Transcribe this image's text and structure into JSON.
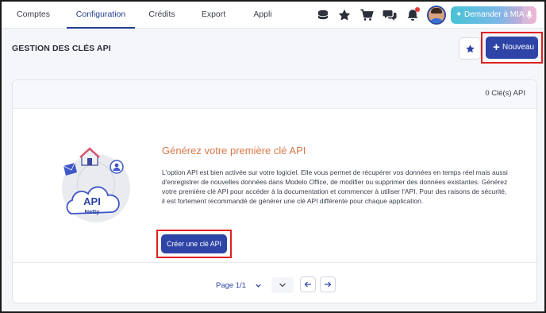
{
  "nav": {
    "tabs": [
      {
        "label": "Comptes",
        "active": false
      },
      {
        "label": "Configuration",
        "active": true
      },
      {
        "label": "Crédits",
        "active": false
      },
      {
        "label": "Export",
        "active": false
      },
      {
        "label": "Appli",
        "active": false
      }
    ],
    "icons": [
      "coins-icon",
      "star-icon",
      "cart-icon",
      "chat-icon",
      "bell-icon"
    ],
    "ask_button": "Demander à MIA"
  },
  "header": {
    "title": "GESTION DES CLÉS API",
    "new_button": "Nouveau"
  },
  "card": {
    "count_label": "0 Clé(s) API",
    "illustration": {
      "cloud_line1": "API",
      "cloud_line2": "Netty"
    },
    "empty_title": "Générez votre première clé API",
    "empty_text": "L'option API est bien activée sur votre logiciel. Elle vous permet de récupérer vos données en temps réel mais aussi d'enregistrer de nouvelles données dans Modelo Office, de modifier ou supprimer des données existantes. Générez votre première clé API pour accéder à la documentation et commencer à utiliser l'API. Pour des raisons de sécurité, il est fortement recommandé de générer une clé API différente pour chaque application.",
    "create_button": "Créer une clé API",
    "pagination": {
      "page_label": "Page 1/1"
    }
  },
  "colors": {
    "primary": "#2e44a6",
    "accent_orange": "#d9774a",
    "highlight_red": "#e02020",
    "nav_active": "#1f3f8f"
  }
}
